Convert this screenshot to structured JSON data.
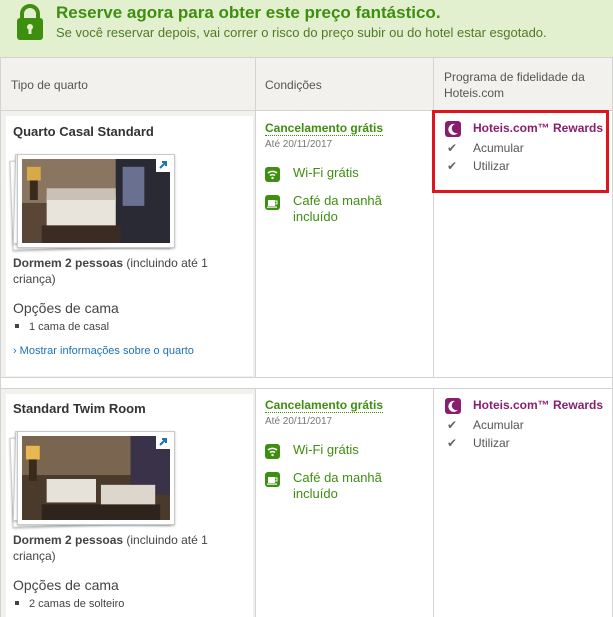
{
  "banner": {
    "title": "Reserve agora para obter este preço fantástico.",
    "subtitle": "Se você reservar depois, vai correr o risco do preço subir ou do hotel estar esgotado."
  },
  "table": {
    "headers": [
      "Tipo de quarto",
      "Condições",
      "Programa de fidelidade da Hoteis.com"
    ]
  },
  "rooms": [
    {
      "name": "Quarto Casal Standard",
      "sleeps_bold": "Dormem 2 pessoas",
      "sleeps_rest": " (incluindo até 1 criança)",
      "bed_title": "Opções de cama",
      "bed_item": "1 cama de casal",
      "more_link": "Mostrar informações sobre o quarto",
      "cancel": "Cancelamento grátis",
      "until": "Até 20/11/2017",
      "wifi": "Wi-Fi grátis",
      "breakfast": "Café da manhã incluído",
      "rewards": "Hoteis.com™ Rewards",
      "collect": "Acumular",
      "redeem": "Utilizar"
    },
    {
      "name": "Standard Twim Room",
      "sleeps_bold": "Dormem 2 pessoas",
      "sleeps_rest": " (incluindo até 1 criança)",
      "bed_title": "Opções de cama",
      "bed_item": "2 camas de solteiro",
      "cancel": "Cancelamento grátis",
      "until": "Até 20/11/2017",
      "wifi": "Wi-Fi grátis",
      "breakfast": "Café da manhã incluído",
      "rewards": "Hoteis.com™ Rewards",
      "collect": "Acumular",
      "redeem": "Utilizar"
    }
  ],
  "colors": {
    "banner_bg": "#e3f0cf",
    "green": "#3e8e10",
    "rewards_purple": "#8a1e6e",
    "highlight_red": "#e0141e",
    "link_blue": "#1a73b8"
  }
}
